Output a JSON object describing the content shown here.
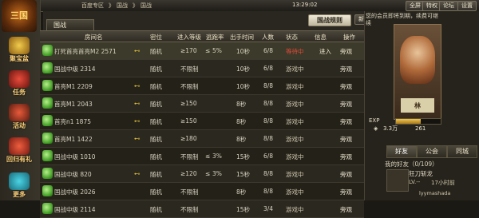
{
  "topbar": {
    "crumb_1": "百度专区",
    "crumb_sep_1": "》",
    "crumb_2": "国战",
    "crumb_sep_2": "》",
    "crumb_3": "国战",
    "time": "13:29:02",
    "buttons": [
      "全屏",
      "特权",
      "论坛",
      "设置"
    ]
  },
  "sidebar": {
    "logo": "三国",
    "items": [
      "聚宝盆",
      "任务",
      "活动",
      "回归有礼",
      "更多"
    ]
  },
  "tabs": {
    "active": "国战",
    "rules_button": "国战规则",
    "cut_button": "新"
  },
  "table": {
    "headers": [
      "房间名",
      "密位",
      "进入等级",
      "逃跑率",
      "出手时间",
      "人数",
      "状态",
      "信息",
      "操作"
    ],
    "rows": [
      {
        "name": "打死首亮首亮M2 2571",
        "key": "⊷",
        "pos": "随机",
        "level": "≥170",
        "flee_op": "≤",
        "flee": "5%",
        "time": "10秒",
        "people": "6/8",
        "status": "等待中",
        "status_type": "full",
        "info": "进入",
        "action": "旁观",
        "selected": true
      },
      {
        "name": "国战中级 2314",
        "key": "",
        "pos": "随机",
        "level": "不限制",
        "flee_op": "",
        "flee": "",
        "time": "10秒",
        "people": "6/8",
        "status": "游戏中",
        "status_type": "ing",
        "info": "",
        "action": "旁观",
        "selected": false
      },
      {
        "name": "首亮M1 2209",
        "key": "⊷",
        "pos": "随机",
        "level": "不限制",
        "flee_op": "",
        "flee": "",
        "time": "10秒",
        "people": "8/8",
        "status": "游戏中",
        "status_type": "ing",
        "info": "",
        "action": "旁观",
        "selected": false
      },
      {
        "name": "首亮M1 2043",
        "key": "⊷",
        "pos": "随机",
        "level": "≥150",
        "flee_op": "",
        "flee": "",
        "time": "8秒",
        "people": "8/8",
        "status": "游戏中",
        "status_type": "ing",
        "info": "",
        "action": "旁观",
        "selected": false
      },
      {
        "name": "首亮n1 1875",
        "key": "⊷",
        "pos": "随机",
        "level": "≥150",
        "flee_op": "",
        "flee": "",
        "time": "8秒",
        "people": "8/8",
        "status": "游戏中",
        "status_type": "ing",
        "info": "",
        "action": "旁观",
        "selected": false
      },
      {
        "name": "首亮M1 1422",
        "key": "⊷",
        "pos": "随机",
        "level": "≥180",
        "flee_op": "",
        "flee": "",
        "time": "8秒",
        "people": "8/8",
        "status": "游戏中",
        "status_type": "ing",
        "info": "",
        "action": "旁观",
        "selected": false
      },
      {
        "name": "国战中级 1010",
        "key": "",
        "pos": "随机",
        "level": "不限制",
        "flee_op": "≤",
        "flee": "3%",
        "time": "15秒",
        "people": "6/8",
        "status": "游戏中",
        "status_type": "ing",
        "info": "",
        "action": "旁观",
        "selected": false
      },
      {
        "name": "国战中级 820",
        "key": "⊷",
        "pos": "随机",
        "level": "≥120",
        "flee_op": "≤",
        "flee": "3%",
        "time": "15秒",
        "people": "8/8",
        "status": "游戏中",
        "status_type": "ing",
        "info": "",
        "action": "旁观",
        "selected": false
      },
      {
        "name": "国战中级 2026",
        "key": "",
        "pos": "随机",
        "level": "不限制",
        "flee_op": "",
        "flee": "",
        "time": "8秒",
        "people": "8/8",
        "status": "游戏中",
        "status_type": "ing",
        "info": "",
        "action": "旁观",
        "selected": false
      },
      {
        "name": "国战中级 2114",
        "key": "",
        "pos": "随机",
        "level": "不限制",
        "flee_op": "",
        "flee": "",
        "time": "15秒",
        "people": "3/4",
        "status": "游戏中",
        "status_type": "ing",
        "info": "",
        "action": "旁观",
        "selected": false
      }
    ]
  },
  "profile": {
    "notice": "您的会员即将到期，续费可继续",
    "card_label": "林",
    "exp_label": "EXP",
    "exp_fraction": 0.55,
    "currency": "3.3万",
    "count": "261"
  },
  "friends": {
    "tabs": [
      "好友",
      "公会",
      "同城"
    ],
    "header": "我的好友（0/109）",
    "name": "狂刀斩龙",
    "level": "LV.--",
    "time": "17小时前",
    "bottom_name": "lyymashada"
  },
  "colors": {
    "bg": "#1b1914",
    "accent": "#e2c23a",
    "status_full": "#e04a3a"
  }
}
